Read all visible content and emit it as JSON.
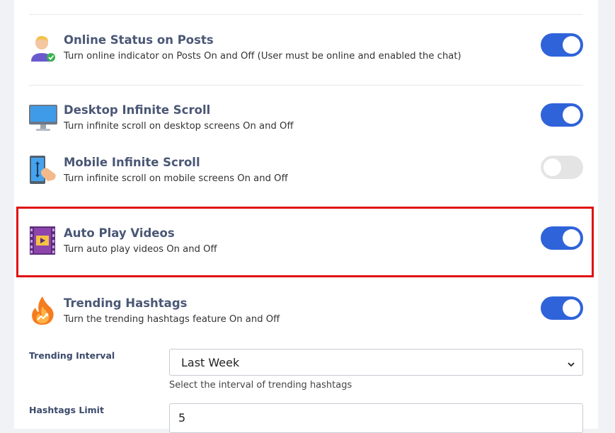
{
  "settings": [
    {
      "title": "Online Status on Posts",
      "description": "Turn online indicator on Posts On and Off (User must be online and enabled the chat)",
      "icon": "user-online-icon",
      "enabled": true
    },
    {
      "title": "Desktop Infinite Scroll",
      "description": "Turn infinite scroll on desktop screens On and Off",
      "icon": "desktop-monitor-icon",
      "enabled": true
    },
    {
      "title": "Mobile Infinite Scroll",
      "description": "Turn infinite scroll on mobile screens On and Off",
      "icon": "mobile-scroll-icon",
      "enabled": false
    },
    {
      "title": "Auto Play Videos",
      "description": "Turn auto play videos On and Off",
      "icon": "film-play-icon",
      "enabled": true
    },
    {
      "title": "Trending Hashtags",
      "description": "Turn the trending hashtags feature On and Off",
      "icon": "fire-trending-icon",
      "enabled": true
    }
  ],
  "trending_interval": {
    "label": "Trending Interval",
    "value": "Last Week",
    "help": "Select the interval of trending hashtags"
  },
  "hashtags_limit": {
    "label": "Hashtags Limit",
    "value": "5"
  },
  "colors": {
    "toggle_on": "#2f63d9",
    "toggle_off": "#e4e4e4",
    "highlight": "#e01010",
    "title": "#4a5775"
  }
}
